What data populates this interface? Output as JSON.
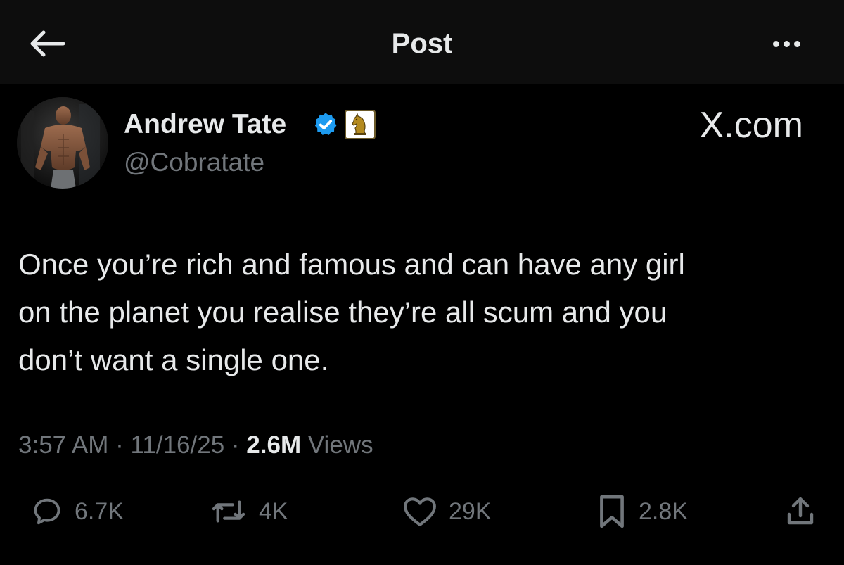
{
  "header": {
    "title": "Post"
  },
  "author": {
    "name": "Andrew Tate",
    "handle": "@Cobratate",
    "verified": true
  },
  "watermark": "X.com",
  "tweet": {
    "text": "Once you’re rich and famous and can have any girl\non the planet you realise they’re all scum and you\ndon’t want a single one."
  },
  "meta": {
    "time": "3:57 AM",
    "separator": " · ",
    "date": "11/16/25",
    "views_count": "2.6M",
    "views_label": "Views"
  },
  "actions": {
    "replies": "6.7K",
    "reposts": "4K",
    "likes": "29K",
    "bookmarks": "2.8K"
  },
  "colors": {
    "background": "#000000",
    "text_primary": "#e7e9ea",
    "text_secondary": "#71767b",
    "verified_blue": "#1d9bf0"
  }
}
